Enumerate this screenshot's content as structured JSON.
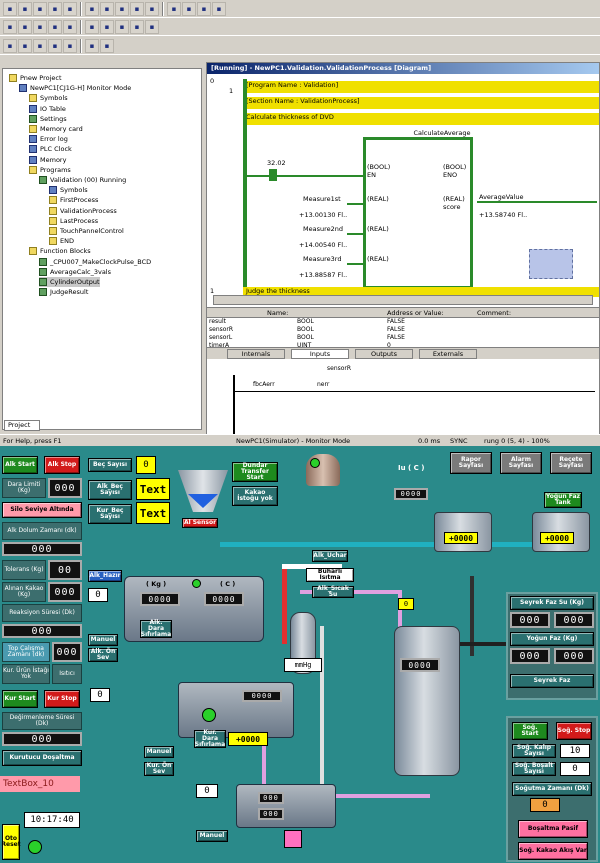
{
  "toolbar1": [
    "new",
    "open",
    "save",
    "print-preview",
    "print",
    "cut",
    "copy",
    "paste",
    "undo",
    "redo",
    "find",
    "replace",
    "help",
    "jump"
  ],
  "toolbar2": [
    "zoom-in",
    "zoom-out",
    "select",
    "cont-no",
    "cont-nc",
    "coil",
    "coil-not",
    "line",
    "function-block",
    "new-rung"
  ],
  "toolbar3": [
    "project",
    "properties",
    "io-table",
    "memory",
    "grid",
    "stepin",
    "stepout"
  ],
  "tree": {
    "items": [
      {
        "label": "Pnew Project",
        "level": 0
      },
      {
        "label": "NewPC1[CJ1G-H] Monitor Mode",
        "level": 1
      },
      {
        "label": "Symbols",
        "level": 2
      },
      {
        "label": "IO Table",
        "level": 2
      },
      {
        "label": "Settings",
        "level": 2
      },
      {
        "label": "Memory card",
        "level": 2
      },
      {
        "label": "Error log",
        "level": 2
      },
      {
        "label": "PLC Clock",
        "level": 2
      },
      {
        "label": "Memory",
        "level": 2
      },
      {
        "label": "Programs",
        "level": 2
      },
      {
        "label": "Validation (00) Running",
        "level": 3
      },
      {
        "label": "Symbols",
        "level": 4
      },
      {
        "label": "FirstProcess",
        "level": 4
      },
      {
        "label": "ValidationProcess",
        "level": 4
      },
      {
        "label": "LastProcess",
        "level": 4
      },
      {
        "label": "TouchPannelControl",
        "level": 4
      },
      {
        "label": "END",
        "level": 4
      },
      {
        "label": "Function Blocks",
        "level": 2
      },
      {
        "label": "_CPU007_MakeClockPulse_BCD",
        "level": 3
      },
      {
        "label": "AverageCalc_3vals",
        "level": 3
      },
      {
        "label": "CylinderOutput",
        "level": 3
      },
      {
        "label": "JudgeResult",
        "level": 3
      }
    ],
    "tab": "Project"
  },
  "diagram": {
    "title": "[Running] - NewPC1.Validation.ValidationProcess [Diagram]",
    "rung0": "0",
    "rung0_sub": "1",
    "program_name": "[Program Name : Validation]",
    "section_name": "[Section Name : ValidationProcess]",
    "comment": "Calculate thickness of DVD",
    "fb_instance": "CalculateAverage",
    "fb_type": "AverageCalc_3vals",
    "contact_value": "32.02",
    "inputs": [
      {
        "name": "Measure1st",
        "type": "(REAL)",
        "value": "+13.00130 Fl.."
      },
      {
        "name": "Measure2nd",
        "type": "(REAL)",
        "value": "+14.00540 Fl.."
      },
      {
        "name": "Measure3rd",
        "type": "(REAL)",
        "value": "+13.88587 Fl.."
      }
    ],
    "en_label": "(BOOL)\nEN",
    "eno_label": "(BOOL)\nENO",
    "score_label": "(REAL)\nscore",
    "output_name": "AverageValue",
    "output_value": "+13.58740 Fl..",
    "rung1": "1",
    "rung1_comment": "Judge the thickness"
  },
  "watch": {
    "headers": [
      "Name:",
      "Address or Value:",
      "Comment:"
    ],
    "rows": [
      {
        "name": "result",
        "type": "BOOL",
        "value": "FALSE"
      },
      {
        "name": "sensorR",
        "type": "BOOL",
        "value": "FALSE"
      },
      {
        "name": "sensorL",
        "type": "BOOL",
        "value": "FALSE"
      },
      {
        "name": "timerA",
        "type": "UINT",
        "value": "0"
      }
    ],
    "tabs": [
      "Internals",
      "Inputs",
      "Outputs",
      "Externals"
    ]
  },
  "ladder": {
    "labels": [
      "sensorR",
      "fbcAerr",
      "nerr"
    ]
  },
  "status": {
    "help": "For Help, press F1",
    "mode": "NewPC1(Simulator) - Monitor Mode",
    "time": "0.0 ms",
    "sync": "SYNC",
    "rung": "rung 0 (5, 4) - 100%"
  },
  "hmi": {
    "alk_start": "Alk Start",
    "alk_stop": "Alk Stop",
    "dara_limit": "Dara Limiti (Kg)",
    "dara_limit_val": "000",
    "silo_seviye": "Silo Seviye Altında",
    "alk_dolum": "Alk Dolum Zamanı (dk)",
    "tolerans": "Tolerans (Kg)",
    "tolerans_val": "00",
    "alinan_kakao": "Alınan Kakao (Kg)",
    "alinan_kakao_val": "000",
    "reaksiyon": "Reaksiyon Süresi (Dk)",
    "top_calisma": "Top Çalışma Zamanı (dk)",
    "kur_urun": "Kur. Ürün İstağı Yok",
    "isıtıcı": "Isıtıcı",
    "kur_start": "Kur Start",
    "kur_stop": "Kur Stop",
    "degirmen": "Değirmenleme Süresi (Dk)",
    "kurutucu": "Kurutucu Doşaltma",
    "textbox": "TextBox_10",
    "oto_reset": "Oto Reset",
    "clock": "10:17:40",
    "bec_sayisi": "Beç Sayısı",
    "bec_val": "0",
    "alk_bec": "Alk_Beç Sayısı",
    "alk_bec_val": "Text",
    "kur_bec": "Kur_Beç Sayısı",
    "kur_bec_val": "Text",
    "al_sensor": "Al Sensor",
    "dunder": "Dundar Transfer Start",
    "kakao_istogu": "Kakao İstoğu yok",
    "alk_hazir": "Alk_Hazır",
    "kg_label": "( Kg )",
    "c_label": "( C )",
    "alk_dara": "Alk. Dara Sıfırlama",
    "manual1": "Manuel",
    "alk_on_sev": "Alk. Ön Sev",
    "alk_uchar": "Alk_Uchar",
    "buhar": "Buharlı Isıtma",
    "alk_sicak": "Alk_Sıcak Su",
    "mmhg": "mmHg",
    "iu_c": "Iu ( C )",
    "rapor": "Rapor Sayfası",
    "alarm": "Alarm Sayfası",
    "recete": "Reçete Sayfası",
    "yogun_faz": "Yoğun Faz Tank",
    "seyrek_faz_su": "Seyrek Faz Su (Kg)",
    "yogun_faz_kg": "Yoğun Faz (Kg)",
    "seyrek_faz": "Seyrek Faz",
    "kur_dara": "Kur. Dara Sıfırlama",
    "manuel2": "Manuel",
    "kur_on_sev": "Kur. Ön Sev",
    "manuel3": "Manuel",
    "sog_start": "Soğ. Start",
    "sog_stop": "Soğ. Stop",
    "sog_kalip": "Soğ. Kalıp Sayısı",
    "sog_kalip_val": "10",
    "sog_bosalt": "Soğ. Boşalt Sayısı",
    "sog_bosalt_val": "0",
    "sogutma": "Soğutma Zamanı (Dk)",
    "sogutma_val": "0",
    "bosaltma": "Boşaltma Pasif",
    "sog_kakao": "Soğ. Kakao Akış Var",
    "digits": "000",
    "digits5": "+0000",
    "digits_kg": "0000",
    "zero": "0",
    "colors": {
      "teal": "#2a8a8a",
      "green": "#1e8a1e",
      "red": "#d21a1a",
      "yellow": "#ffff00"
    }
  }
}
